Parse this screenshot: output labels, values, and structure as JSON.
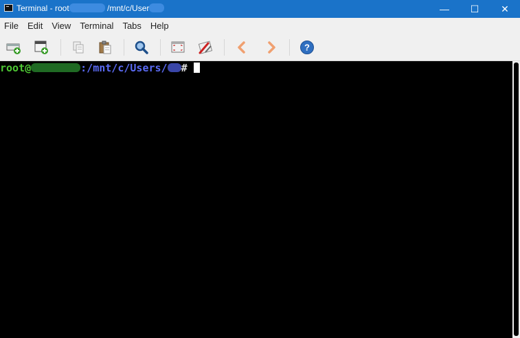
{
  "titlebar": {
    "title_prefix": "Terminal - root",
    "title_path": "/mnt/c/User",
    "controls": {
      "minimize": "—",
      "maximize": "☐",
      "close": "✕"
    }
  },
  "menubar": {
    "items": [
      "File",
      "Edit",
      "View",
      "Terminal",
      "Tabs",
      "Help"
    ]
  },
  "toolbar": {
    "buttons": [
      {
        "name": "new-tab-icon"
      },
      {
        "name": "new-window-icon"
      },
      {
        "name": "copy-icon"
      },
      {
        "name": "paste-icon"
      },
      {
        "name": "search-icon"
      },
      {
        "name": "fullscreen-icon"
      },
      {
        "name": "preferences-icon"
      },
      {
        "name": "previous-tab-icon"
      },
      {
        "name": "next-tab-icon"
      },
      {
        "name": "help-icon"
      }
    ]
  },
  "terminal": {
    "user": "root@",
    "path": ":/mnt/c/Users/",
    "symbol": "# "
  },
  "colors": {
    "titlebar": "#1a73c9",
    "prompt_user": "#4ec934",
    "prompt_path": "#5b6bf5",
    "background": "#000000"
  }
}
